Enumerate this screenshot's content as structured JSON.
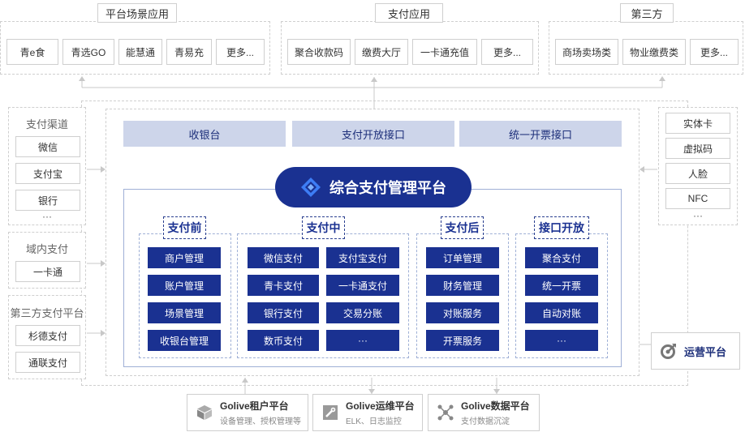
{
  "top": {
    "scene": {
      "title": "平台场景应用",
      "items": [
        "青e食",
        "青选GO",
        "能慧通",
        "青易充",
        "更多..."
      ]
    },
    "payment": {
      "title": "支付应用",
      "items": [
        "聚合收款码",
        "缴费大厅",
        "一卡通充值",
        "更多..."
      ]
    },
    "third": {
      "title": "第三方",
      "items": [
        "商场卖场类",
        "物业缴费类",
        "更多..."
      ]
    }
  },
  "left": {
    "channel": {
      "title": "支付渠道",
      "items": [
        "微信",
        "支付宝",
        "银行"
      ],
      "more": "···"
    },
    "domain": {
      "title": "域内支付",
      "items": [
        "一卡通"
      ]
    },
    "thirdparty": {
      "title": "第三方支付平台",
      "items": [
        "杉德支付",
        "通联支付"
      ]
    }
  },
  "right": {
    "items": [
      "实体卡",
      "虚拟码",
      "人脸",
      "NFC"
    ],
    "more": "···",
    "ops": "运营平台"
  },
  "center": {
    "topbar": [
      "收银台",
      "支付开放接口",
      "统一开票接口"
    ],
    "banner": "综合支付管理平台",
    "columns": {
      "before": {
        "title": "支付前",
        "items": [
          "商户管理",
          "账户管理",
          "场景管理",
          "收银台管理"
        ]
      },
      "during": {
        "title": "支付中",
        "left": [
          "微信支付",
          "青卡支付",
          "银行支付",
          "数币支付"
        ],
        "right": [
          "支付宝支付",
          "一卡通支付",
          "交易分账",
          "···"
        ]
      },
      "after": {
        "title": "支付后",
        "items": [
          "订单管理",
          "财务管理",
          "对账服务",
          "开票服务"
        ]
      },
      "api": {
        "title": "接口开放",
        "items": [
          "聚合支付",
          "统一开票",
          "自动对账",
          "···"
        ]
      }
    }
  },
  "bottom": [
    {
      "title": "Golive租户平台",
      "sub": "设备管理、授权管理等",
      "icon": "cube-icon"
    },
    {
      "title": "Golive运维平台",
      "sub": "ELK、日志监控",
      "icon": "wrench-icon"
    },
    {
      "title": "Golive数据平台",
      "sub": "支付数据沉淀",
      "icon": "network-icon"
    }
  ],
  "colors": {
    "navy": "#1a3191",
    "light": "#cdd5ea",
    "border": "#cfcfcf"
  }
}
